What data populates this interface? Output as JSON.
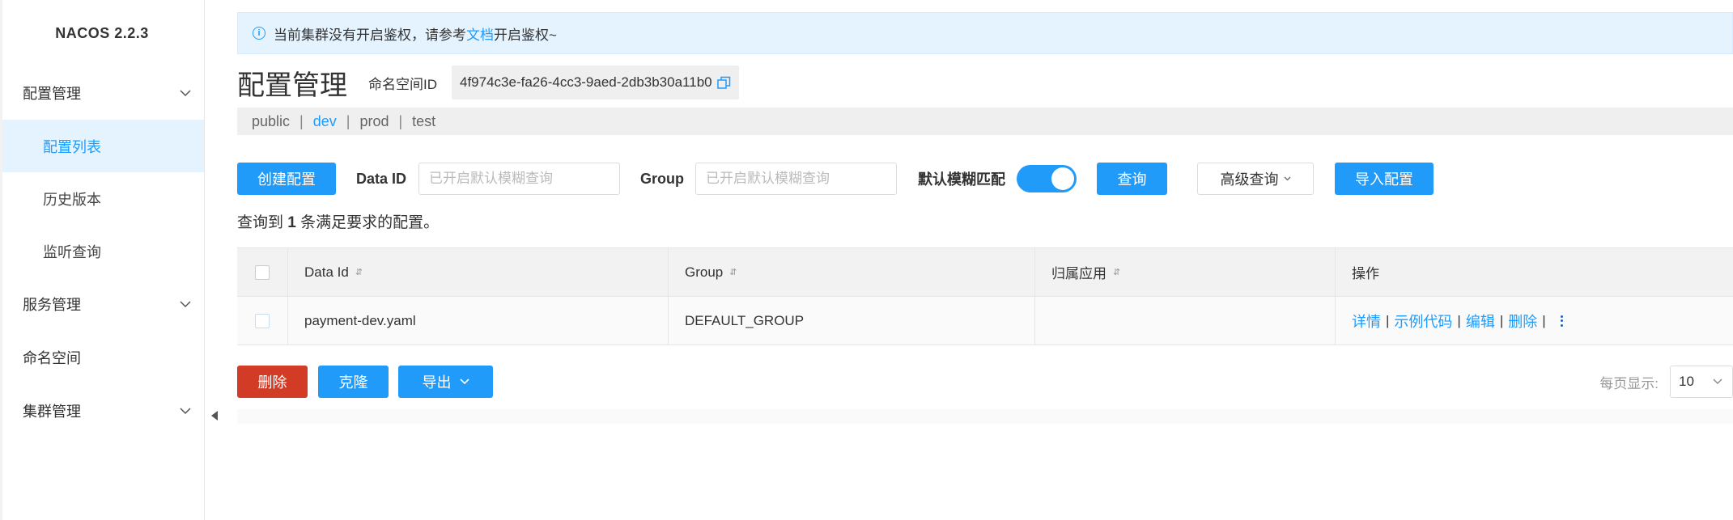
{
  "sidebar": {
    "brand": "NACOS 2.2.3",
    "groups": [
      {
        "label": "配置管理"
      },
      {
        "label": "服务管理"
      },
      {
        "label": "命名空间"
      },
      {
        "label": "集群管理"
      }
    ],
    "config_items": [
      {
        "label": "配置列表"
      },
      {
        "label": "历史版本"
      },
      {
        "label": "监听查询"
      }
    ]
  },
  "alert": {
    "text_before": "当前集群没有开启鉴权，请参考",
    "link": "文档",
    "text_after": "开启鉴权~"
  },
  "header": {
    "title": "配置管理",
    "namespace_label": "命名空间ID",
    "namespace_id": "4f974c3e-fa26-4cc3-9aed-2db3b30a11b0"
  },
  "namespaces": [
    "public",
    "dev",
    "prod",
    "test"
  ],
  "namespace_separator": "|",
  "toolbar": {
    "create_label": "创建配置",
    "data_id_label": "Data ID",
    "data_id_placeholder": "已开启默认模糊查询",
    "group_label": "Group",
    "group_placeholder": "已开启默认模糊查询",
    "fuzzy_label": "默认模糊匹配",
    "query_label": "查询",
    "advanced_label": "高级查询",
    "import_label": "导入配置"
  },
  "result": {
    "prefix": "查询到",
    "count": "1",
    "suffix": "条满足要求的配置。"
  },
  "table": {
    "headers": {
      "data_id": "Data Id",
      "group": "Group",
      "app": "归属应用",
      "ops": "操作"
    },
    "rows": [
      {
        "data_id": "payment-dev.yaml",
        "group": "DEFAULT_GROUP",
        "app": "",
        "ops": [
          "详情",
          "示例代码",
          "编辑",
          "删除"
        ]
      }
    ]
  },
  "bottom": {
    "delete_label": "删除",
    "clone_label": "克隆",
    "export_label": "导出"
  },
  "pager": {
    "label": "每页显示:",
    "page_size": "10"
  },
  "colors": {
    "primary": "#209bfa",
    "danger": "#d23c26",
    "active_bg": "#e5f3ff"
  }
}
